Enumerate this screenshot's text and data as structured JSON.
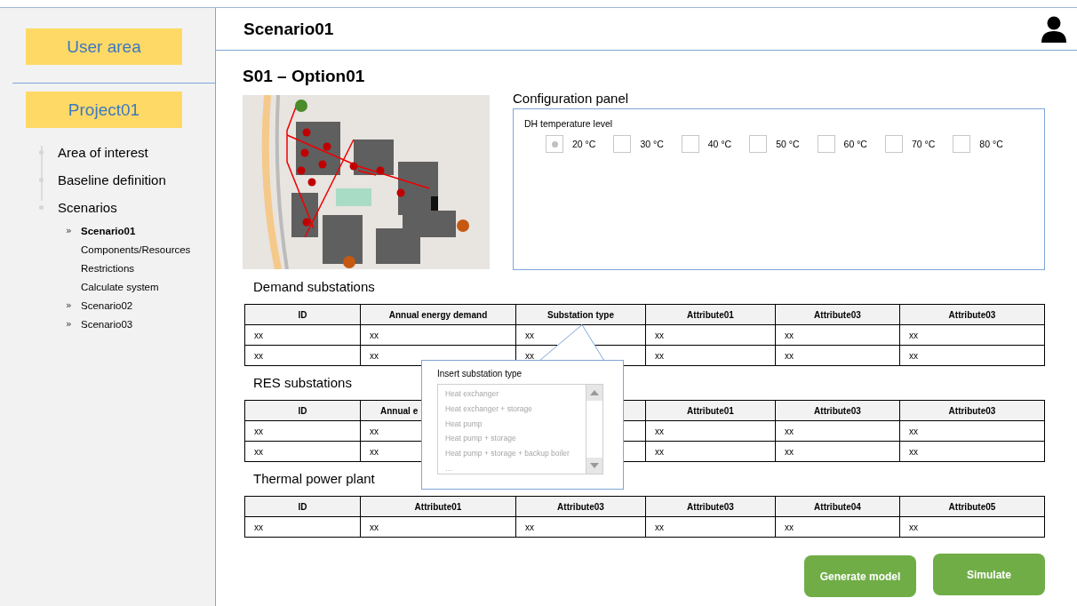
{
  "sidebar": {
    "user_area": "User area",
    "project": "Project01",
    "items": [
      {
        "label": "Area of interest"
      },
      {
        "label": "Baseline definition"
      },
      {
        "label": "Scenarios",
        "children": [
          {
            "marker": "»",
            "label": "Scenario01",
            "selected": true,
            "expanded": true,
            "children": [
              {
                "label": "Components/Resources"
              },
              {
                "label": "Restrictions"
              },
              {
                "label": "Calculate system"
              }
            ]
          },
          {
            "marker": "»",
            "label": "Scenario02",
            "selected": false,
            "expanded": false
          },
          {
            "marker": "»",
            "label": "Scenario03",
            "selected": false,
            "expanded": false
          }
        ]
      }
    ]
  },
  "header": {
    "title": "Scenario01"
  },
  "page_title": "S01 – Option01",
  "config_panel": {
    "title": "Configuration panel",
    "group_label": "DH temperature level",
    "options": [
      {
        "label": "20 °C",
        "selected": true
      },
      {
        "label": "30 °C",
        "selected": false
      },
      {
        "label": "40 °C",
        "selected": false
      },
      {
        "label": "50 °C",
        "selected": false
      },
      {
        "label": "60 °C",
        "selected": false
      },
      {
        "label": "70 °C",
        "selected": false
      },
      {
        "label": "80 °C",
        "selected": false
      }
    ]
  },
  "tables": [
    {
      "title": "Demand substations",
      "columns": [
        "ID",
        "Annual energy demand",
        "Substation type",
        "Attribute01",
        "Attribute03",
        "Attribute03"
      ],
      "rows": [
        [
          "xx",
          "xx",
          "xx",
          "xx",
          "xx",
          "xx"
        ],
        [
          "xx",
          "xx",
          "xx",
          "xx",
          "xx",
          "xx"
        ]
      ]
    },
    {
      "title": "RES substations",
      "columns": [
        "ID",
        "Annual e",
        null,
        "Attribute01",
        "Attribute03",
        "Attribute03"
      ],
      "rows": [
        [
          "xx",
          "xx",
          null,
          "xx",
          "xx",
          "xx"
        ],
        [
          "xx",
          "xx",
          null,
          "xx",
          "xx",
          "xx"
        ]
      ]
    },
    {
      "title": "Thermal power plant",
      "columns": [
        "ID",
        "Attribute01",
        "Attribute03",
        "Attribute03",
        "Attribute04",
        "Attribute05"
      ],
      "rows": [
        [
          "xx",
          "xx",
          "xx",
          "xx",
          "xx",
          "xx"
        ]
      ]
    }
  ],
  "popup": {
    "title": "Insert substation type",
    "items": [
      "Heat exchanger",
      "Heat exchanger + storage",
      "Heat pump",
      "Heat pump + storage",
      "Heat pump + storage + backup boiler",
      "…"
    ]
  },
  "buttons": [
    {
      "label": "Generate model"
    },
    {
      "label": "Simulate"
    }
  ]
}
